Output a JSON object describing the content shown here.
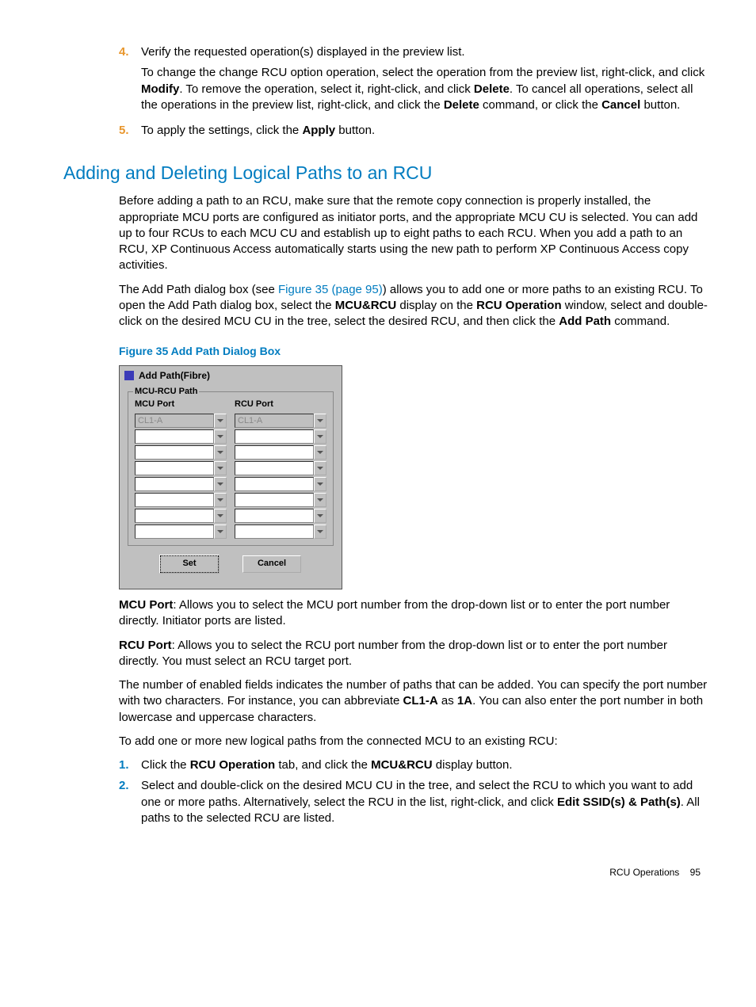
{
  "steps_top": [
    {
      "num": "4.",
      "lines": [
        "Verify the requested operation(s) displayed in the preview list.",
        "To change the change RCU option operation, select the operation from the preview list, right-click, and click <b>Modify</b>. To remove the operation, select it, right-click, and click <b>Delete</b>. To cancel all operations, select all the operations in the preview list, right-click, and click the <b>Delete</b> command, or click the <b>Cancel</b> button."
      ]
    },
    {
      "num": "5.",
      "lines": [
        "To apply the settings, click the <b>Apply</b> button."
      ]
    }
  ],
  "section_title": "Adding and Deleting Logical Paths to an RCU",
  "para1": "Before adding a path to an RCU, make sure that the remote copy connection is properly installed, the appropriate MCU ports are configured as initiator ports, and the appropriate MCU CU is selected. You can add up to four RCUs to each MCU CU and establish up to eight paths to each RCU. When you add a path to an RCU, XP Continuous Access automatically starts using the new path to perform XP Continuous Access copy activities.",
  "para2_pre": "The Add Path dialog box (see ",
  "para2_link": "Figure 35 (page 95)",
  "para2_post": ") allows you to add one or more paths to an existing RCU. To open the Add Path dialog box, select the <b>MCU&RCU</b> display on the <b>RCU Operation</b> window, select and double-click on the desired MCU CU in the tree, select the desired RCU, and then click the <b>Add Path</b> command.",
  "figure_caption": "Figure 35 Add Path Dialog Box",
  "dialog": {
    "title": "Add Path(Fibre)",
    "group_label": "MCU-RCU Path",
    "mcu_header": "MCU Port",
    "rcu_header": "RCU Port",
    "rows": [
      {
        "mcu": "CL1-A",
        "rcu": "CL1-A",
        "disabled": true
      },
      {
        "mcu": "",
        "rcu": "",
        "disabled": false
      },
      {
        "mcu": "",
        "rcu": "",
        "disabled": false
      },
      {
        "mcu": "",
        "rcu": "",
        "disabled": false
      },
      {
        "mcu": "",
        "rcu": "",
        "disabled": false
      },
      {
        "mcu": "",
        "rcu": "",
        "disabled": false
      },
      {
        "mcu": "",
        "rcu": "",
        "disabled": false
      },
      {
        "mcu": "",
        "rcu": "",
        "disabled": false
      }
    ],
    "set_btn": "Set",
    "cancel_btn": "Cancel"
  },
  "def_mcu": "<b>MCU Port</b>: Allows you to select the MCU port number from the drop-down list or to enter the port number directly. Initiator ports are listed.",
  "def_rcu": "<b>RCU Port</b>: Allows you to select the RCU port number from the drop-down list or to enter the port number directly. You must select an RCU target port.",
  "para3": "The number of enabled fields indicates the number of paths that can be added. You can specify the port number with two characters. For instance, you can abbreviate <b>CL1-A</b> as <b>1A</b>. You can also enter the port number in both lowercase and uppercase characters.",
  "para4": "To add one or more new logical paths from the connected MCU to an existing RCU:",
  "steps_bottom": [
    {
      "num": "1.",
      "text": "Click the <b>RCU Operation</b> tab, and click the <b>MCU&RCU</b> display button."
    },
    {
      "num": "2.",
      "text": "Select and double-click on the desired MCU CU in the tree, and select the RCU to which you want to add one or more paths. Alternatively, select the RCU in the list, right-click, and click <b>Edit SSID(s) & Path(s)</b>. All paths to the selected RCU are listed."
    }
  ],
  "footer_section": "RCU Operations",
  "footer_page": "95"
}
